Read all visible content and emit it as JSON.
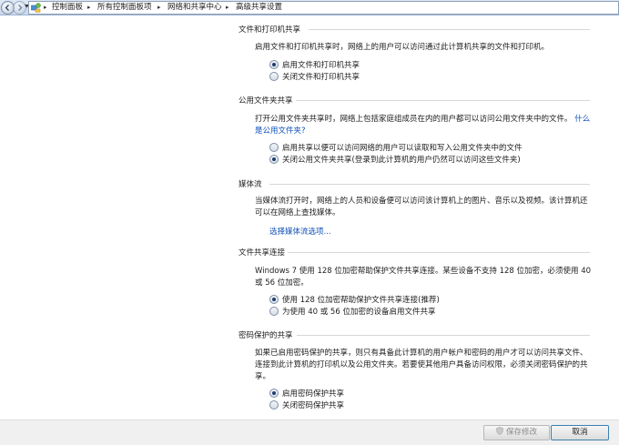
{
  "breadcrumb": {
    "items": [
      "控制面板",
      "所有控制面板项",
      "网络和共享中心",
      "高级共享设置"
    ]
  },
  "sections": [
    {
      "title": "文件和打印机共享",
      "description": "启用文件和打印机共享时，网络上的用户可以访问通过此计算机共享的文件和打印机。",
      "options": [
        {
          "label": "启用文件和打印机共享",
          "selected": true
        },
        {
          "label": "关闭文件和打印机共享",
          "selected": false
        }
      ]
    },
    {
      "title": "公用文件夹共享",
      "description": "打开公用文件夹共享时，网络上包括家庭组成员在内的用户都可以访问公用文件夹中的文件。",
      "link": "什么是公用文件夹?",
      "options": [
        {
          "label": "启用共享以便可以访问网络的用户可以读取和写入公用文件夹中的文件",
          "selected": false
        },
        {
          "label": "关闭公用文件夹共享(登录到此计算机的用户仍然可以访问这些文件夹)",
          "selected": true
        }
      ]
    },
    {
      "title": "媒体流",
      "description": "当媒体流打开时，网络上的人员和设备便可以访问该计算机上的图片、音乐以及视频。该计算机还可以在网络上查找媒体。",
      "link": "选择媒体流选项..."
    },
    {
      "title": "文件共享连接",
      "description": "Windows 7 使用 128 位加密帮助保护文件共享连接。某些设备不支持 128 位加密，必须使用 40 或 56 位加密。",
      "options": [
        {
          "label": "使用 128 位加密帮助保护文件共享连接(推荐)",
          "selected": true
        },
        {
          "label": "为使用 40 或 56 位加密的设备启用文件共享",
          "selected": false
        }
      ]
    },
    {
      "title": "密码保护的共享",
      "description": "如果已启用密码保护的共享，则只有具备此计算机的用户帐户和密码的用户才可以访问共享文件、连接到此计算机的打印机以及公用文件夹。若要使其他用户具备访问权限，必须关闭密码保护的共享。",
      "options": [
        {
          "label": "启用密码保护共享",
          "selected": true
        },
        {
          "label": "关闭密码保护共享",
          "selected": false
        }
      ]
    }
  ],
  "buttons": {
    "save": "保存修改",
    "cancel": "取消"
  },
  "icons": {
    "back": "back-arrow-icon",
    "forward": "forward-arrow-icon",
    "control_panel": "control-panel-icon",
    "shield": "uac-shield-icon"
  }
}
